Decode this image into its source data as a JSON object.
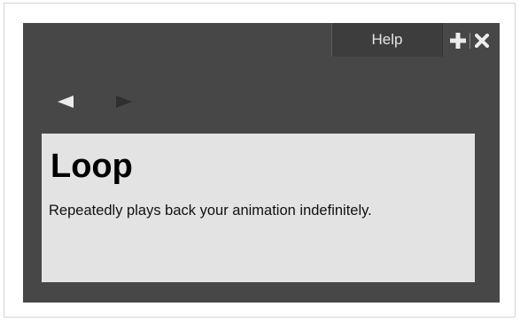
{
  "panel": {
    "tab_label": "Help",
    "controls": {
      "add_icon": "plus-icon",
      "close_icon": "close-icon"
    },
    "navigation": {
      "back_icon": "triangle-left-icon",
      "forward_icon": "triangle-right-icon",
      "back_enabled": true,
      "forward_enabled": false
    },
    "content": {
      "title": "Loop",
      "description": "Repeatedly plays back your animation indefinitely."
    },
    "colors": {
      "panel_bg": "#474747",
      "tab_bg": "#3d3d3d",
      "content_bg": "#e3e3e3",
      "icon_light": "#ececec",
      "icon_disabled": "#2f2f2f"
    }
  }
}
